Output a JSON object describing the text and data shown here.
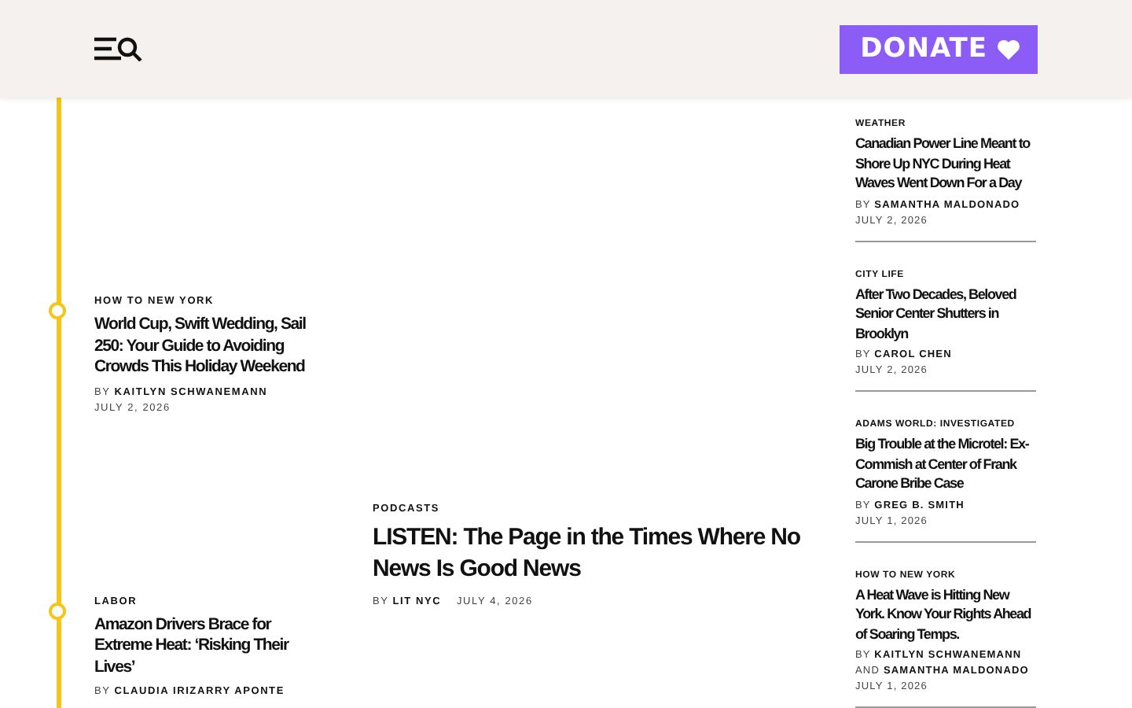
{
  "header": {
    "donate_label": "DONATE"
  },
  "timeline_stories": [
    {
      "section": "HOW TO NEW YORK",
      "headline": "World Cup, Swift Wedding, Sail 250: Your Guide to Avoiding Crowds This Holiday Weekend",
      "by": "BY",
      "authors": [
        "KAITLYN SCHWANEMANN"
      ],
      "date": "JULY 2, 2026"
    },
    {
      "section": "LABOR",
      "headline": "Amazon Drivers Brace for Extreme Heat: ‘Risking Their Lives’",
      "by": "BY",
      "authors": [
        "CLAUDIA IRIZARRY APONTE"
      ]
    }
  ],
  "feature_story": {
    "section": "PODCASTS",
    "headline": "LISTEN: The Page in the Times Where No News Is Good News",
    "by": "BY",
    "authors": [
      "LIT NYC"
    ],
    "date": "JULY 4, 2026"
  },
  "sidebar_stories": [
    {
      "section": "WEATHER",
      "headline": "Canadian Power Line Meant to Shore Up NYC During Heat Waves Went Down For a Day",
      "by": "BY",
      "authors": [
        "SAMANTHA MALDONADO"
      ],
      "date": "JULY 2, 2026"
    },
    {
      "section": "CITY LIFE",
      "headline": "After Two Decades, Beloved Senior Center Shutters in Brooklyn",
      "by": "BY",
      "authors": [
        "CAROL CHEN"
      ],
      "date": "JULY 2, 2026"
    },
    {
      "section": "ADAMS WORLD: INVESTIGATED",
      "headline": "Big Trouble at the Microtel: Ex-Commish at Center of Frank Carone Bribe Case",
      "by": "BY",
      "authors": [
        "GREG B. SMITH"
      ],
      "date": "JULY 1, 2026"
    },
    {
      "section": "HOW TO NEW YORK",
      "headline": "A Heat Wave is Hitting New York. Know Your Rights Ahead of Soaring Temps.",
      "by": "BY",
      "authors": [
        "KAITLYN SCHWANEMANN"
      ],
      "and": "AND",
      "authors2": [
        "SAMANTHA MALDONADO"
      ],
      "date": "JULY 1, 2026"
    }
  ]
}
